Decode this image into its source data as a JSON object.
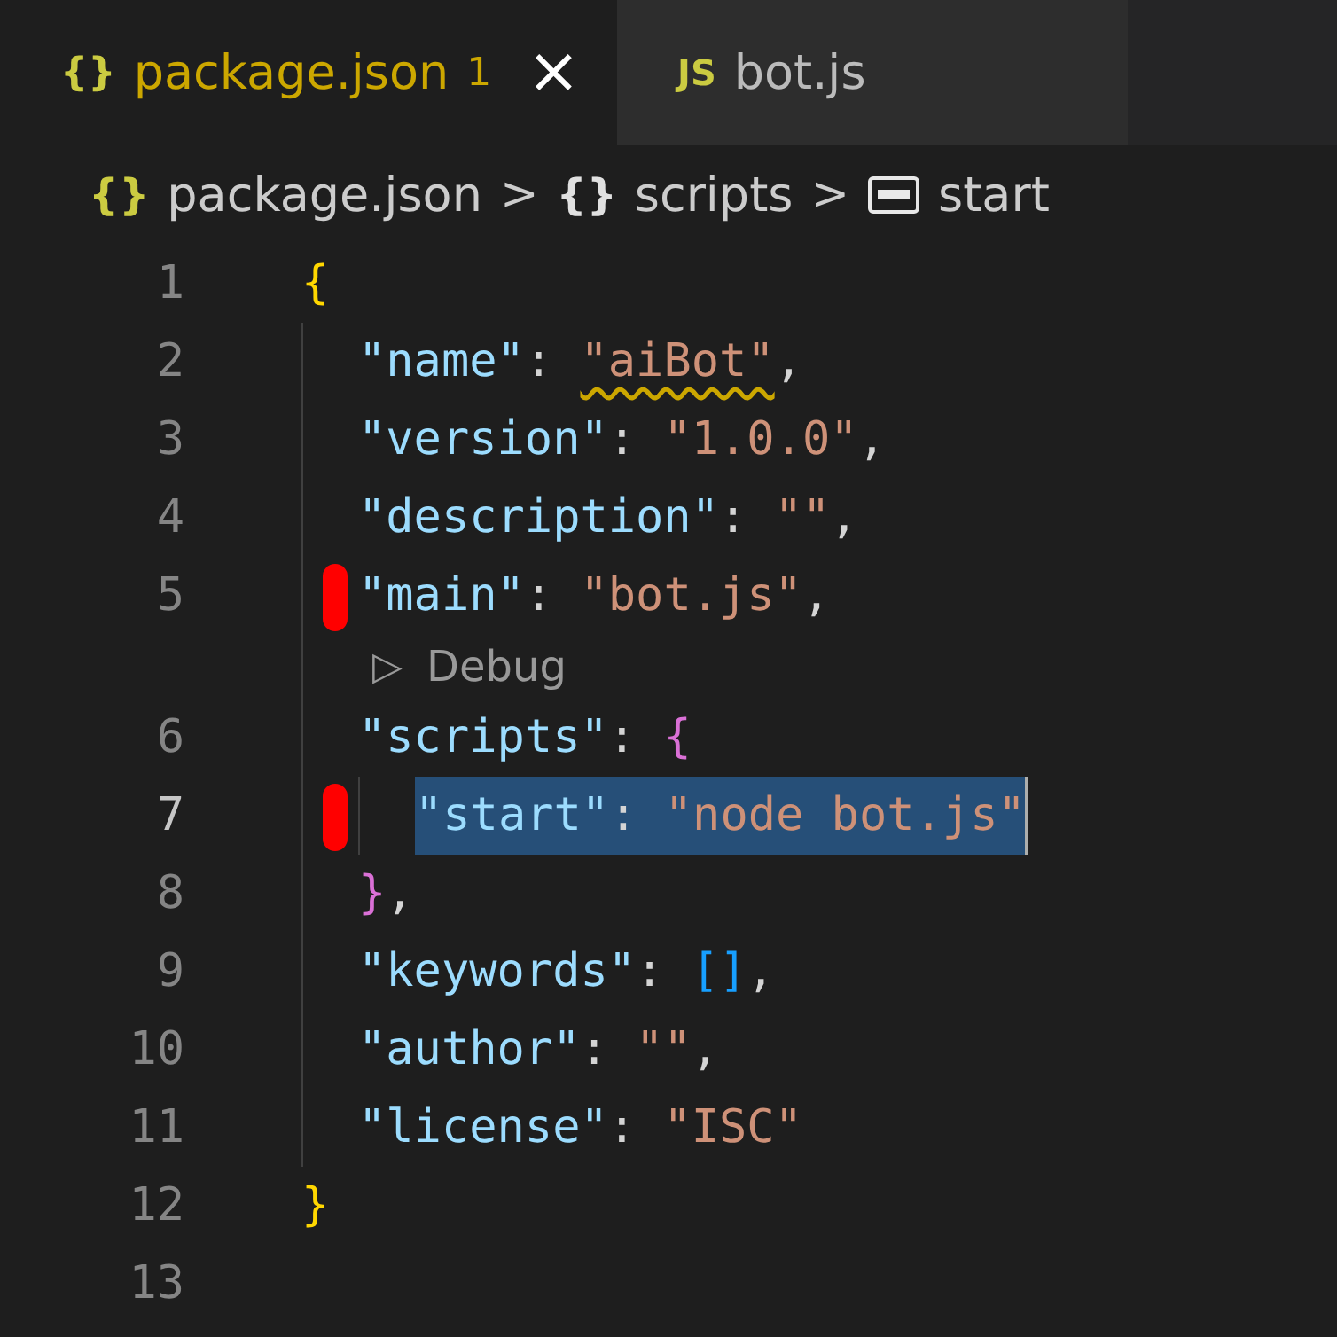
{
  "tabs": [
    {
      "icon": "{}",
      "label": "package.json",
      "badge": "1",
      "close": "×",
      "selected": true,
      "problem": true
    },
    {
      "icon": "JS",
      "label": "bot.js",
      "selected": false,
      "problem": false
    }
  ],
  "breadcrumbs": [
    {
      "kind": "json",
      "icon": "{}",
      "label": "package.json"
    },
    {
      "kind": "object",
      "icon": "{}",
      "label": "scripts"
    },
    {
      "kind": "string",
      "label": "start"
    }
  ],
  "separator": ">",
  "lines": [
    {
      "kind": "code",
      "number": "1",
      "tokens": [
        {
          "t": "{",
          "kind": "brace1"
        }
      ]
    },
    {
      "kind": "code",
      "number": "2",
      "tokens": [
        {
          "t": "  \"name\"",
          "kind": "key"
        },
        {
          "t": ": ",
          "kind": "punct"
        },
        {
          "t": "\"aiBot\"",
          "kind": "string",
          "squiggle": true
        },
        {
          "t": ",",
          "kind": "punct"
        }
      ]
    },
    {
      "kind": "code",
      "number": "3",
      "tokens": [
        {
          "t": "  \"version\"",
          "kind": "key"
        },
        {
          "t": ": ",
          "kind": "punct"
        },
        {
          "t": "\"1.0.0\"",
          "kind": "string"
        },
        {
          "t": ",",
          "kind": "punct"
        }
      ]
    },
    {
      "kind": "code",
      "number": "4",
      "tokens": [
        {
          "t": "  \"description\"",
          "kind": "key"
        },
        {
          "t": ": ",
          "kind": "punct"
        },
        {
          "t": "\"\"",
          "kind": "string"
        },
        {
          "t": ",",
          "kind": "punct"
        }
      ]
    },
    {
      "kind": "code",
      "number": "5",
      "marked": true,
      "tokens": [
        {
          "t": "  \"main\"",
          "kind": "key"
        },
        {
          "t": ": ",
          "kind": "punct"
        },
        {
          "t": "\"bot.js\"",
          "kind": "string"
        },
        {
          "t": ",",
          "kind": "punct"
        }
      ]
    },
    {
      "kind": "codelens",
      "icon": "▷",
      "text": "Debug"
    },
    {
      "kind": "code",
      "number": "6",
      "tokens": [
        {
          "t": "  \"scripts\"",
          "kind": "key"
        },
        {
          "t": ": ",
          "kind": "punct"
        },
        {
          "t": "{",
          "kind": "brace2"
        }
      ]
    },
    {
      "kind": "code",
      "number": "7",
      "marked": true,
      "selected": true,
      "tokens": [
        {
          "t": "    \"start\"",
          "kind": "key"
        },
        {
          "t": ": ",
          "kind": "punct"
        },
        {
          "t": "\"node bot.js\"",
          "kind": "string"
        }
      ]
    },
    {
      "kind": "code",
      "number": "8",
      "tokens": [
        {
          "t": "  }",
          "kind": "brace2"
        },
        {
          "t": ",",
          "kind": "punct"
        }
      ]
    },
    {
      "kind": "code",
      "number": "9",
      "tokens": [
        {
          "t": "  \"keywords\"",
          "kind": "key"
        },
        {
          "t": ": ",
          "kind": "punct"
        },
        {
          "t": "[]",
          "kind": "brace3"
        },
        {
          "t": ",",
          "kind": "punct"
        }
      ]
    },
    {
      "kind": "code",
      "number": "10",
      "tokens": [
        {
          "t": "  \"author\"",
          "kind": "key"
        },
        {
          "t": ": ",
          "kind": "punct"
        },
        {
          "t": "\"\"",
          "kind": "string"
        },
        {
          "t": ",",
          "kind": "punct"
        }
      ]
    },
    {
      "kind": "code",
      "number": "11",
      "tokens": [
        {
          "t": "  \"license\"",
          "kind": "key"
        },
        {
          "t": ": ",
          "kind": "punct"
        },
        {
          "t": "\"ISC\"",
          "kind": "string"
        }
      ]
    },
    {
      "kind": "code",
      "number": "12",
      "tokens": [
        {
          "t": "}",
          "kind": "brace1"
        }
      ]
    },
    {
      "kind": "code",
      "number": "13"
    }
  ]
}
